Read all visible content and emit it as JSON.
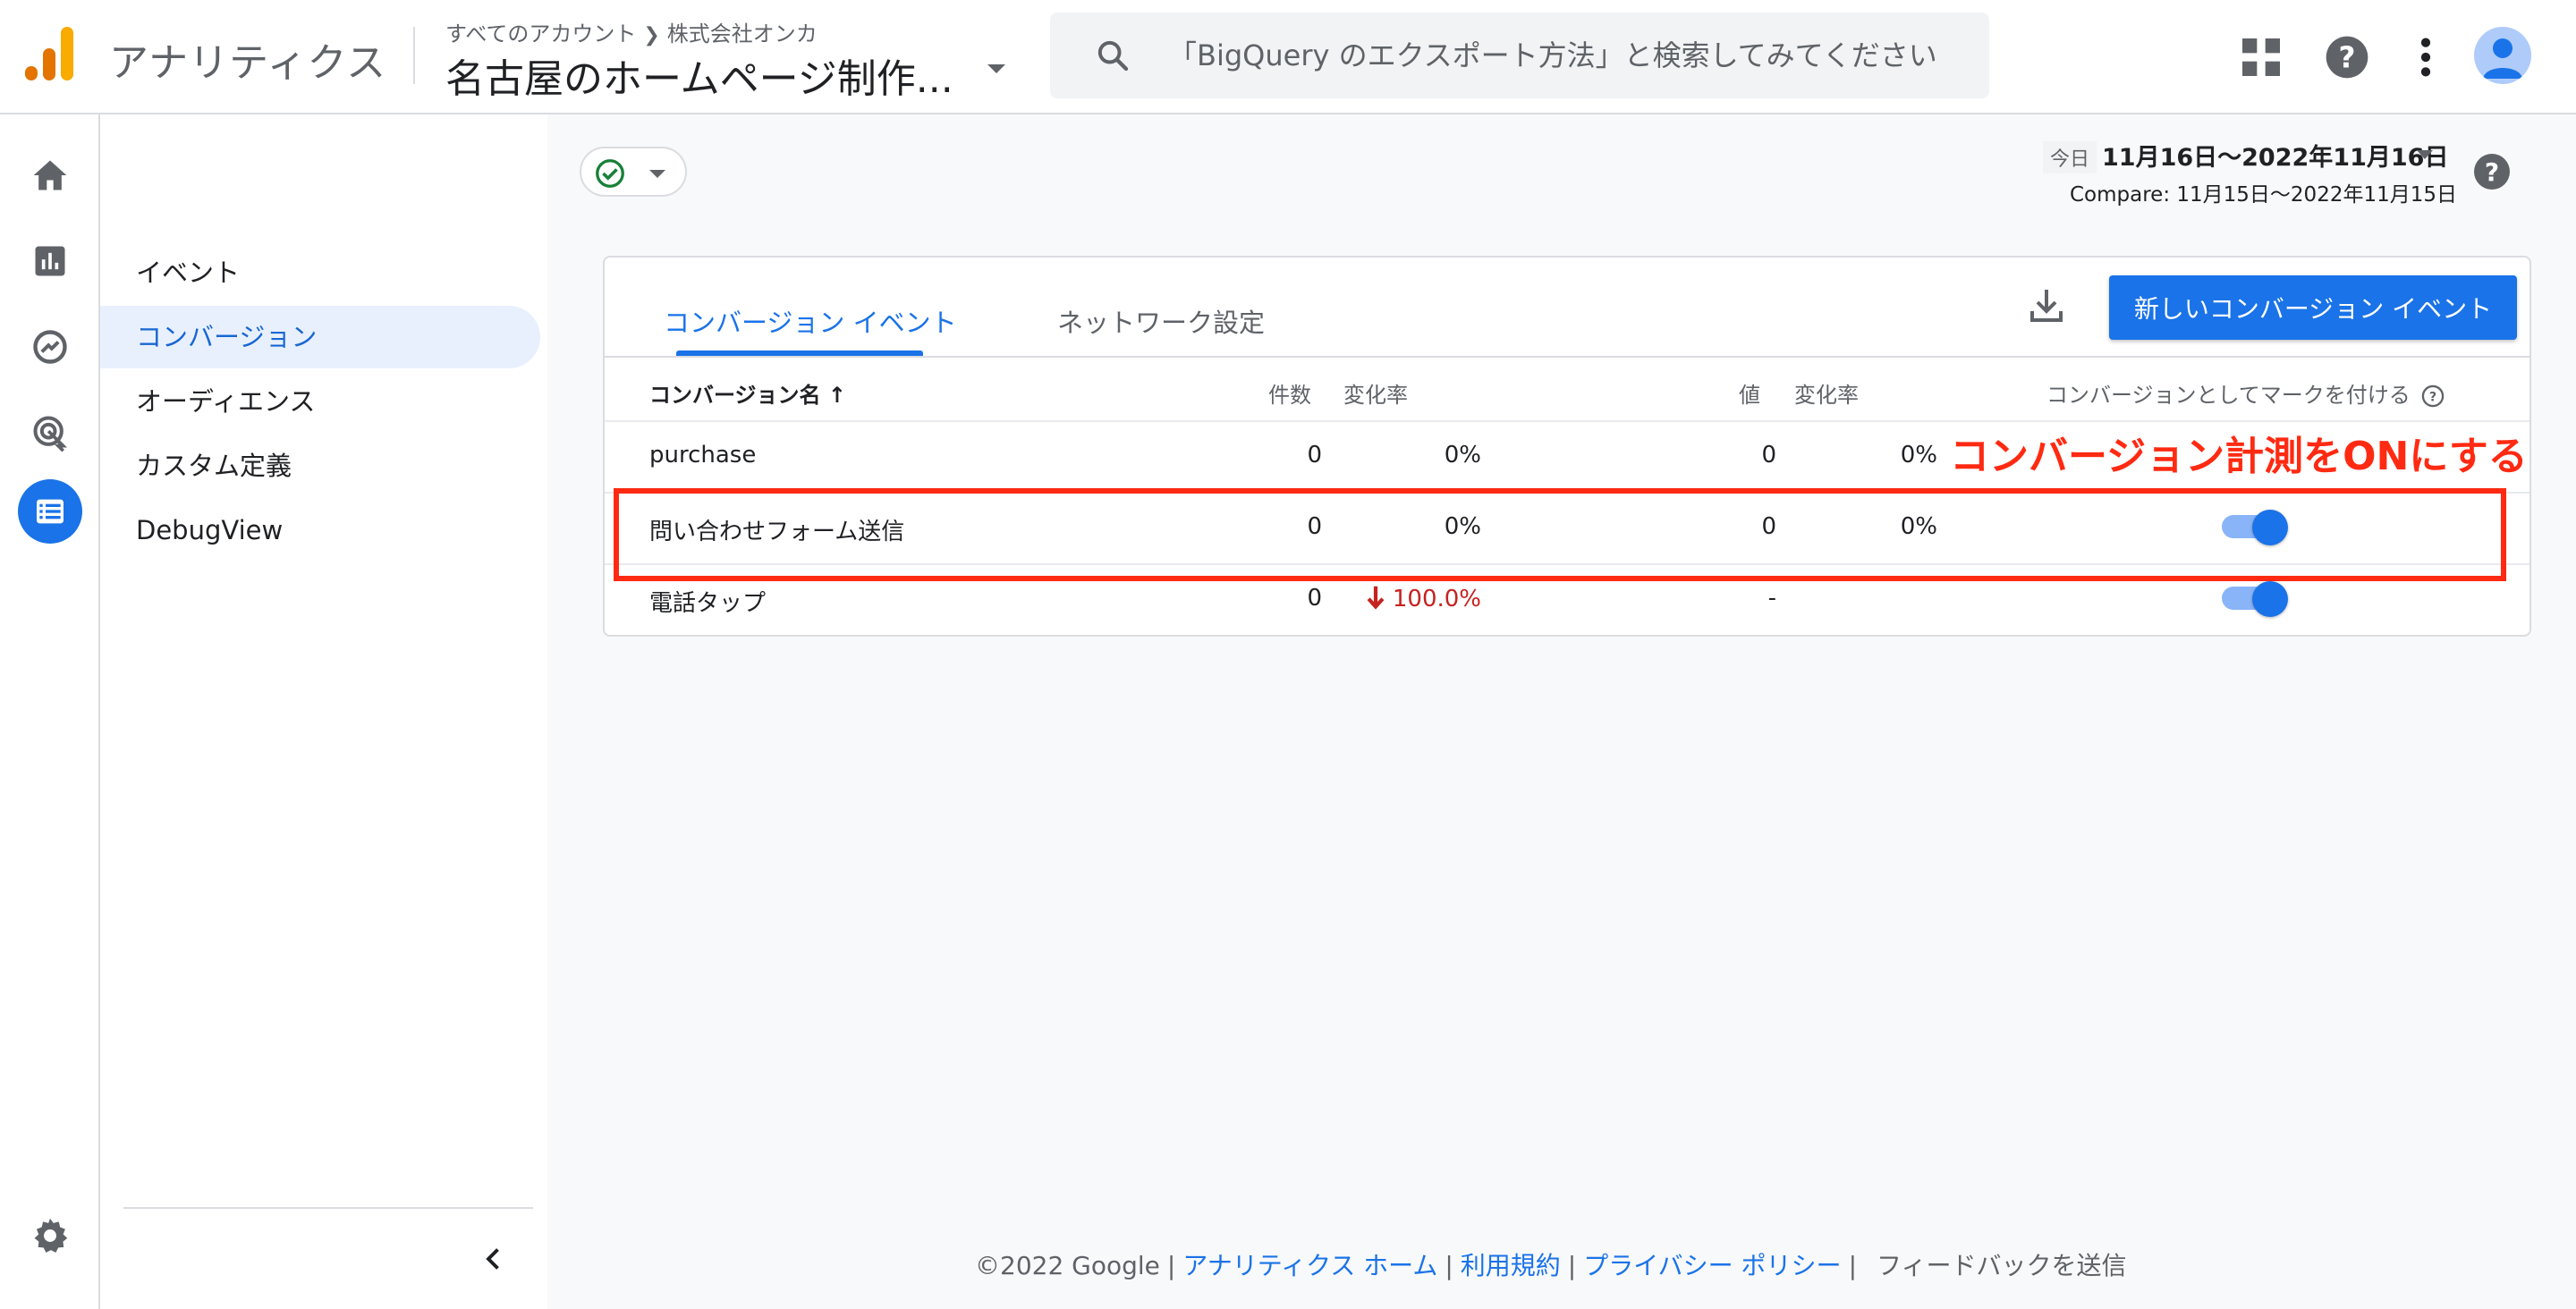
{
  "header": {
    "app_name": "アナリティクス",
    "breadcrumb_all": "すべてのアカウント",
    "breadcrumb_account": "株式会社オンカ",
    "property_name": "名古屋のホームページ制作...",
    "search_placeholder": "「BigQuery のエクスポート方法」と検索してみてください"
  },
  "rail": {
    "icons": [
      "home-icon",
      "reports-icon",
      "explore-icon",
      "advertising-icon",
      "configure-icon",
      "settings-icon"
    ],
    "active": "configure-icon"
  },
  "subnav": {
    "items": [
      "イベント",
      "コンバージョン",
      "オーディエンス",
      "カスタム定義",
      "DebugView"
    ],
    "active_index": 1
  },
  "date": {
    "label": "今日",
    "range": "11月16日〜2022年11月16日",
    "compare": "Compare: 11月15日〜2022年11月15日"
  },
  "card": {
    "tabs": [
      "コンバージョン イベント",
      "ネットワーク設定"
    ],
    "active_tab": 0,
    "new_button": "新しいコンバージョン イベント",
    "columns": {
      "name": "コンバージョン名 ↑",
      "count": "件数",
      "count_change": "変化率",
      "value": "値",
      "value_change": "変化率",
      "mark": "コンバージョンとしてマークを付ける"
    },
    "rows": [
      {
        "name": "purchase",
        "count": "0",
        "count_change": "0%",
        "value": "0",
        "value_change": "0%",
        "toggle": null
      },
      {
        "name": "問い合わせフォーム送信",
        "count": "0",
        "count_change": "0%",
        "value": "0",
        "value_change": "0%",
        "toggle": true
      },
      {
        "name": "電話タップ",
        "count": "0",
        "count_change": "100.0%",
        "count_change_direction": "down",
        "value": "-",
        "value_change": "",
        "toggle": true
      }
    ]
  },
  "annotation": {
    "text": "コンバージョン計測をONにする",
    "color": "#ff2a12"
  },
  "footer": {
    "copyright": "©2022 Google",
    "links": [
      "アナリティクス ホーム",
      "利用規約",
      "プライバシー ポリシー"
    ],
    "feedback": "フィードバックを送信"
  },
  "colors": {
    "accent": "#1a73e8",
    "negative": "#c5221f",
    "success": "#188038"
  }
}
